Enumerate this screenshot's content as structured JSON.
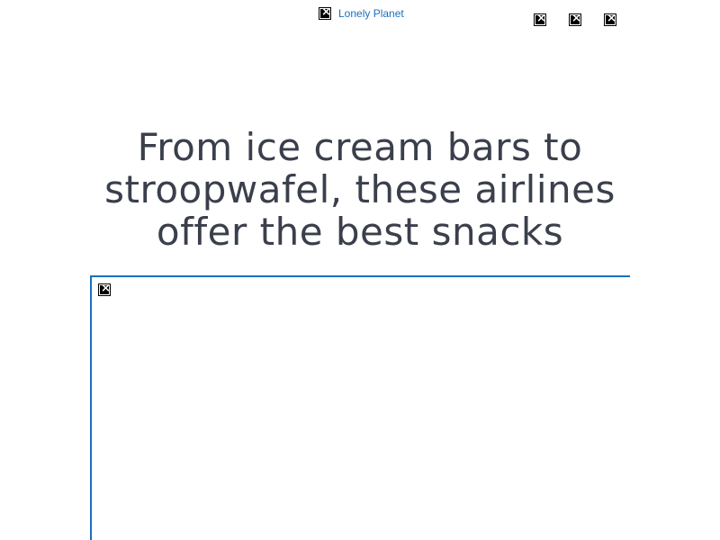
{
  "header": {
    "logo_alt": "Lonely Planet",
    "logo_icon": "broken-image-icon",
    "actions": [
      {
        "icon": "broken-image-icon"
      },
      {
        "icon": "broken-image-icon"
      },
      {
        "icon": "broken-image-icon"
      }
    ]
  },
  "article": {
    "headline": "From ice cream bars to stroopwafel, these airlines offer the best snacks",
    "hero_image_icon": "broken-image-icon"
  },
  "colors": {
    "link": "#1a6fbd",
    "headline_text": "#3a3f4b",
    "frame_border": "#1a6fbd",
    "background": "#ffffff"
  }
}
